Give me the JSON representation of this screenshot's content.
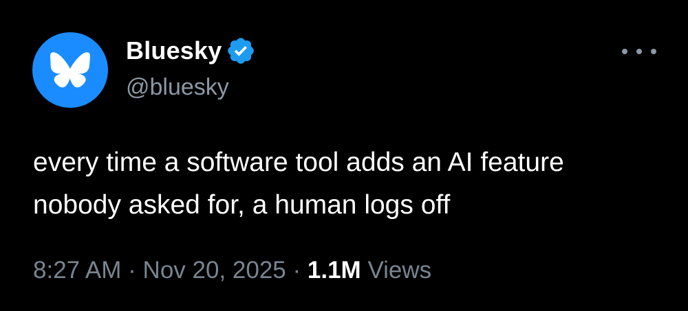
{
  "post": {
    "author": {
      "display_name": "Bluesky",
      "handle": "@bluesky",
      "verified": true,
      "avatar_icon": "butterfly-logo-icon",
      "avatar_color": "#1a8cff",
      "verified_color": "#1d9bf0"
    },
    "text_lines": [
      "every time a software tool adds an AI feature",
      "nobody asked for, a human logs off"
    ],
    "time": "8:27 AM",
    "separator": "·",
    "date": "Nov 20, 2025",
    "views_count": "1.1M",
    "views_label": "Views",
    "more_icon": "more-options-icon"
  }
}
